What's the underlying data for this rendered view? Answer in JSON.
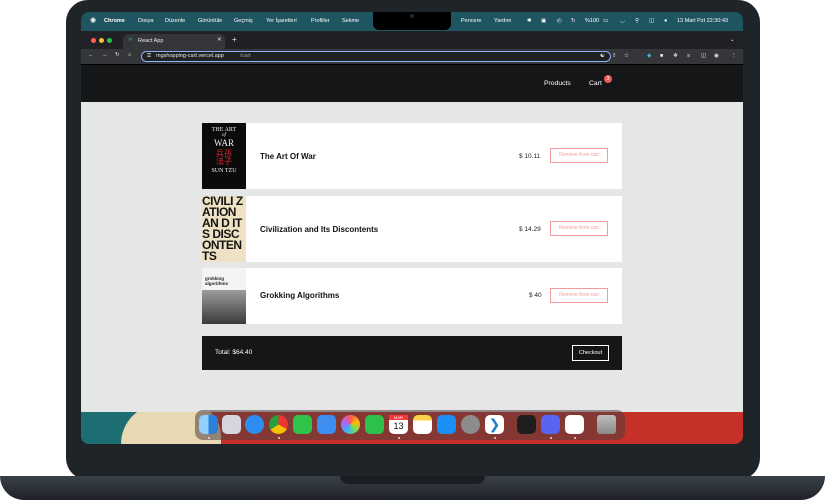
{
  "menubar": {
    "apple": "",
    "app": "Chrome",
    "items": [
      "Dosya",
      "Düzenle",
      "Görüntüle",
      "Geçmiş",
      "Yer İşaretleri",
      "Profiller",
      "Sekme"
    ],
    "right_items": [
      "Pencere",
      "Yardım"
    ],
    "battery": "%100",
    "datetime": "13 Mart Pzt  22:30:43"
  },
  "browser": {
    "tab_title": "React App",
    "url_host": "mgshopping-cart.vercel.app",
    "url_path": "/cart"
  },
  "nav": {
    "products": "Products",
    "cart": "Cart",
    "cart_count": "3"
  },
  "cart": {
    "items": [
      {
        "title": "The Art Of War",
        "price": "$ 10.11",
        "remove": "Remove from cart"
      },
      {
        "title": "Civilization and Its Discontents",
        "price": "$ 14.29",
        "remove": "Remove from cart"
      },
      {
        "title": "Grokking Algorithms",
        "price": "$ 40",
        "remove": "Remove from cart"
      }
    ],
    "covers": {
      "art_of_war": {
        "line1": "THE ART",
        "line2": "of",
        "line3": "WAR",
        "author": "SUN TZU"
      },
      "civilization": {
        "text": "CIVILI ZATION AN D ITS DISC ONTENTS"
      },
      "grokking": {
        "title": "grokking algorithms"
      }
    },
    "total": "Total: $64.40",
    "checkout": "Checkout"
  },
  "dock": {
    "calendar_month": "MAR",
    "calendar_day": "13",
    "apps": [
      "finder-icon",
      "launchpad-icon",
      "safari-icon",
      "chrome-icon",
      "messages-icon",
      "mail-icon",
      "photos-icon",
      "facetime-icon",
      "calendar-icon",
      "notes-icon",
      "app-store-icon",
      "settings-icon",
      "vscode-icon",
      "figma-icon",
      "discord-icon",
      "slack-icon",
      "trash-icon"
    ]
  },
  "colors": {
    "menubar": "#1e5560",
    "app_header": "#151617",
    "page_bg": "#e5e6e6",
    "remove_accent": "#f39a9a",
    "badge": "#f05a5a"
  }
}
